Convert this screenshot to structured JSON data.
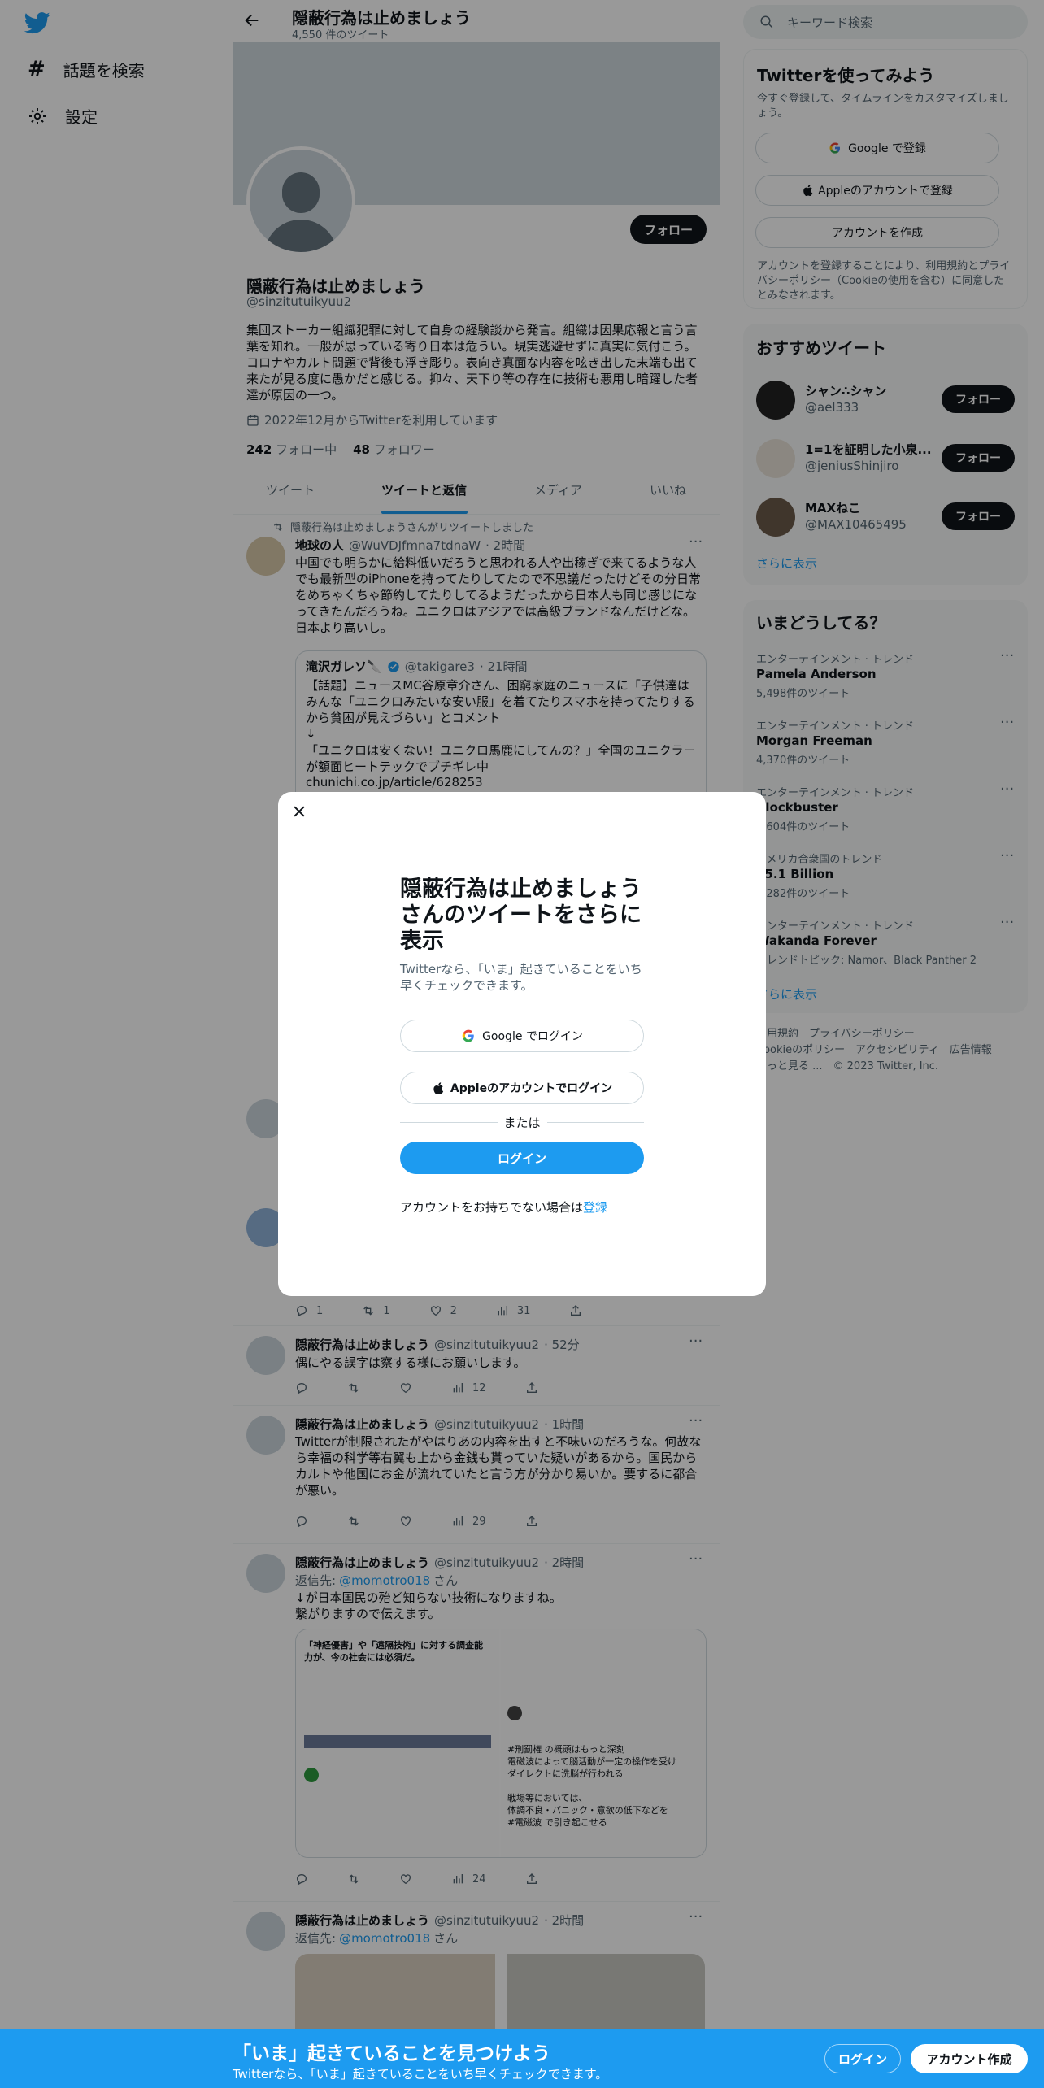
{
  "nav": {
    "explore": "話題を検索",
    "settings": "設定"
  },
  "header": {
    "name": "隠蔽行為は止めましょう",
    "tweet_count": "4,550 件のツイート"
  },
  "profile": {
    "name": "隠蔽行為は止めましょう",
    "handle": "@sinzitutuikyuu2",
    "follow_label": "フォロー",
    "bio": "集団ストーカー組織犯罪に対して自身の経験談から発言。組織は因果応報と言う言葉を知れ。一般が思っている寄り日本は危うい。現実逃避せずに真実に気付こう。コロナやカルト問題で背後も浮き彫り。表向き真面な内容を呟き出した末端も出て来たが見る度に愚かだと感じる。抑々、天下り等の存在に技術も悪用し暗躍した者達が原因の一つ。",
    "joined": "2022年12月からTwitterを利用しています",
    "following_count": "242",
    "following_label": "フォロー中",
    "followers_count": "48",
    "followers_label": "フォロワー"
  },
  "tabs": [
    "ツイート",
    "ツイートと返信",
    "メディア",
    "いいね"
  ],
  "retweet_note": "隠蔽行為は止めましょうさんがリツイートしました",
  "tweet1": {
    "name": "地球の人",
    "handle": "@WuVDJfmna7tdnaW",
    "time": "· 2時間",
    "text": "中国でも明らかに給料低いだろうと思われる人や出稼ぎで来てるような人でも最新型のiPhoneを持ってたりしてたので不思議だったけどその分日常をめちゃくちゃ節約してたりしてるようだったから日本人も同じ感じになってきたんだろうね。ユニクロはアジアでは高級ブランドなんだけどな。日本より高いし。",
    "quote_name": "滝沢ガレソ🔪",
    "quote_handle": "@takigare3",
    "quote_time": "· 21時間",
    "quote_text1": "【話題】ニュースMC谷原章介さん、困窮家庭のニュースに「子供達はみんな「ユニクロみたいな安い服」を着てたりスマホを持ってたりするから貧困が見えづらい」とコメント",
    "quote_text2": "↓",
    "quote_text3": "「ユニクロは安くない！ユニクロ馬鹿にしてんの？」全国のユニクラーが額面ヒートテックでブチギレ中",
    "quote_link": "chunichi.co.jp/article/628253"
  },
  "tweet_under_actions": {
    "reply": "1",
    "retweet": "1",
    "like": "2",
    "views": "31"
  },
  "tweet2": {
    "name": "隠蔽行為は止めましょう",
    "handle": "@sinzitutuikyuu2",
    "time": "· 52分",
    "text": "偶にやる誤字は察する様にお願いします。",
    "views": "12"
  },
  "tweet3": {
    "name": "隠蔽行為は止めましょう",
    "handle": "@sinzitutuikyuu2",
    "time": "· 1時間",
    "text": "Twitterが制限されたがやはりあの内容を出すと不味いのだろうな。何故なら幸福の科学等右翼も上から金銭も貰っていた疑いがあるから。国民からカルトや他国にお金が流れていたと言う方が分かり易いか。要するに都合が悪い。",
    "views": "29"
  },
  "tweet4": {
    "name": "隠蔽行為は止めましょう",
    "handle": "@sinzitutuikyuu2",
    "time": "· 2時間",
    "reply_to_prefix": "返信先:",
    "reply_to": "@momotro018",
    "reply_to_suffix": "さん",
    "text": "↓が日本国民の殆ど知らない技術になりますね。\n繋がりますので伝えます。",
    "views": "24",
    "img_caption1": "「神経優害」や「遠隔技術」に対する調査能力が、今の社会には必須だ。",
    "img_caption2": "#刑罰権 の概頭はもっと深刻\n電磁波によって脳活動が一定の操作を受け\nダイレクトに洗脳が行われる\n\n戦場等においては、\n体調不良・パニック・意欲の低下などを\n#電磁波 で引き起こせる"
  },
  "tweet5": {
    "name": "隠蔽行為は止めましょう",
    "handle": "@sinzitutuikyuu2",
    "time": "· 2時間",
    "reply_to_prefix": "返信先:",
    "reply_to": "@momotro018",
    "reply_to_suffix": "さん"
  },
  "search": {
    "placeholder": "キーワード検索"
  },
  "signup_box": {
    "title": "Twitterを使ってみよう",
    "subtitle": "今すぐ登録して、タイムラインをカスタマイズしましょう。",
    "google": "Google で登録",
    "apple": "Appleのアカウントで登録",
    "create": "アカウントを作成",
    "legal": "アカウントを登録することにより、利用規約とプライバシーポリシー（Cookieの使用を含む）に同意したとみなされます。"
  },
  "recommend": {
    "title": "おすすめツイート",
    "follow_label": "フォロー",
    "users": [
      {
        "name": "シャン∴シャン",
        "handle": "@ael333"
      },
      {
        "name": "1=1を証明した小泉...",
        "handle": "@jeniusShinjiro"
      },
      {
        "name": "MAXねこ",
        "handle": "@MAX10465495"
      }
    ],
    "more": "さらに表示"
  },
  "trends": {
    "title": "いまどうしてる？",
    "items": [
      {
        "context": "エンターテインメント · トレンド",
        "name": "Pamela Anderson",
        "count": "5,498件のツイート"
      },
      {
        "context": "エンターテインメント · トレンド",
        "name": "Morgan Freeman",
        "count": "4,370件のツイート"
      },
      {
        "context": "エンターテインメント · トレンド",
        "name": "Blockbuster",
        "count": "5,604件のツイート"
      },
      {
        "context": "アメリカ合衆国のトレンド",
        "name": "$5.1 Billion",
        "count": "5,282件のツイート"
      },
      {
        "context": "エンターテインメント · トレンド",
        "name": "Wakanda Forever",
        "count": "トレンドトピック: Namor、Black Panther 2"
      }
    ],
    "more": "さらに表示"
  },
  "footer": {
    "line1": "利用規約　プライバシーポリシー",
    "line2": "Cookieのポリシー　アクセシビリティ　広告情報",
    "line3": "もっと見る ...　© 2023 Twitter, Inc."
  },
  "modal": {
    "title": "隠蔽行為は止めましょうさんのツイートをさらに表示",
    "subtitle": "Twitterなら、「いま」起きていることをいち早くチェックできます。",
    "google": "Google でログイン",
    "apple": "Appleのアカウントでログイン",
    "or": "または",
    "login": "ログイン",
    "no_account": "アカウントをお持ちでない場合は",
    "signup": "登録"
  },
  "bottom_bar": {
    "title": "「いま」起きていることを見つけよう",
    "subtitle": "Twitterなら、「いま」起きていることをいち早くチェックできます。",
    "login": "ログイン",
    "signup": "アカウント作成"
  },
  "colors": {
    "accent": "#1d9bf0",
    "text": "#0f1419",
    "muted": "#536471",
    "border": "#eff3f4"
  }
}
